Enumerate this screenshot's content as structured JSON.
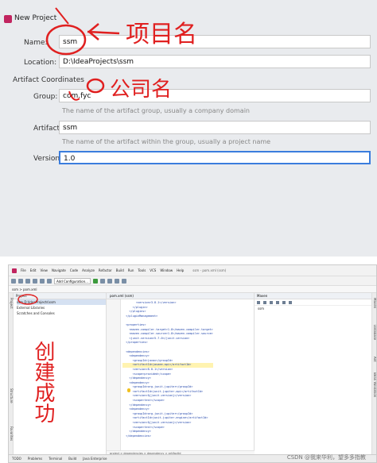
{
  "dialog": {
    "title": "New Project",
    "name_label": "Name:",
    "name_value": "ssm",
    "location_label": "Location:",
    "location_value": "D:\\IdeaProjects\\ssm",
    "artifact_section": "Artifact Coordinates",
    "group_label": "Group:",
    "group_value": "com.fyc",
    "group_hint": "The name of the artifact group, usually a company domain",
    "artifact_label": "Artifact:",
    "artifact_value": "ssm",
    "artifact_hint": "The name of the artifact within the group, usually a project name",
    "version_label": "Version:",
    "version_value": "1.0"
  },
  "annotations": {
    "project_name": "项目名",
    "company_name": "公司名",
    "created": "创建成功",
    "color": "#e02020"
  },
  "ide": {
    "menu": [
      "File",
      "Edit",
      "View",
      "Navigate",
      "Code",
      "Analyze",
      "Refactor",
      "Build",
      "Run",
      "Tools",
      "VCS",
      "Window",
      "Help"
    ],
    "window_title": "ssm - pom.xml (ssm)",
    "run_config": "Add Configuration...",
    "breadcrumb": "ssm  >  pom.xml",
    "project_header": "Project",
    "tree": [
      "ssm  D:\\IdeaProjects\\ssm",
      "External Libraries",
      "Scratches and Consoles"
    ],
    "editor_tab": "pom.xml (ssm)",
    "maven_header": "Maven",
    "maven_tree": [
      "ssm"
    ],
    "left_tools": [
      "Project",
      "Structure",
      "Favorites"
    ],
    "right_tools": [
      "Maven",
      "Database",
      "Ant",
      "Bean Validation"
    ],
    "code_lines": [
      "        <version>3.8.1</version>",
      "      </plugin>",
      "    </plugins>",
      "  </pluginManagement>",
      "",
      "  <properties>",
      "    <maven.compiler.target>1.8</maven.compiler.target>",
      "    <maven.compiler.source>1.8</maven.compiler.source>",
      "    <junit.version>5.7.0</junit.version>",
      "  </properties>",
      "",
      "  <dependencies>",
      "    <dependency>",
      "      <groupId>javax</groupId>",
      "      <artifactId>javaee-api</artifactId>",
      "      <version>8.0.1</version>",
      "      <scope>provided</scope>",
      "    </dependency>",
      "    <dependency>",
      "      <groupId>org.junit.jupiter</groupId>",
      "      <artifactId>junit-jupiter-api</artifactId>",
      "      <version>${junit.version}</version>",
      "      <scope>test</scope>",
      "    </dependency>",
      "    <dependency>",
      "      <groupId>org.junit.jupiter</groupId>",
      "      <artifactId>junit-jupiter-engine</artifactId>",
      "      <version>${junit.version}</version>",
      "      <scope>test</scope>",
      "    </dependency>",
      "  </dependencies>"
    ],
    "code_breadcrumb": "project  >  dependencies  >  dependency  >  artifactId",
    "status_items": [
      "TODO",
      "Problems",
      "Terminal",
      "Build",
      "Java Enterprise"
    ]
  },
  "watermark": "CSDN @我来华利，望多多指教"
}
